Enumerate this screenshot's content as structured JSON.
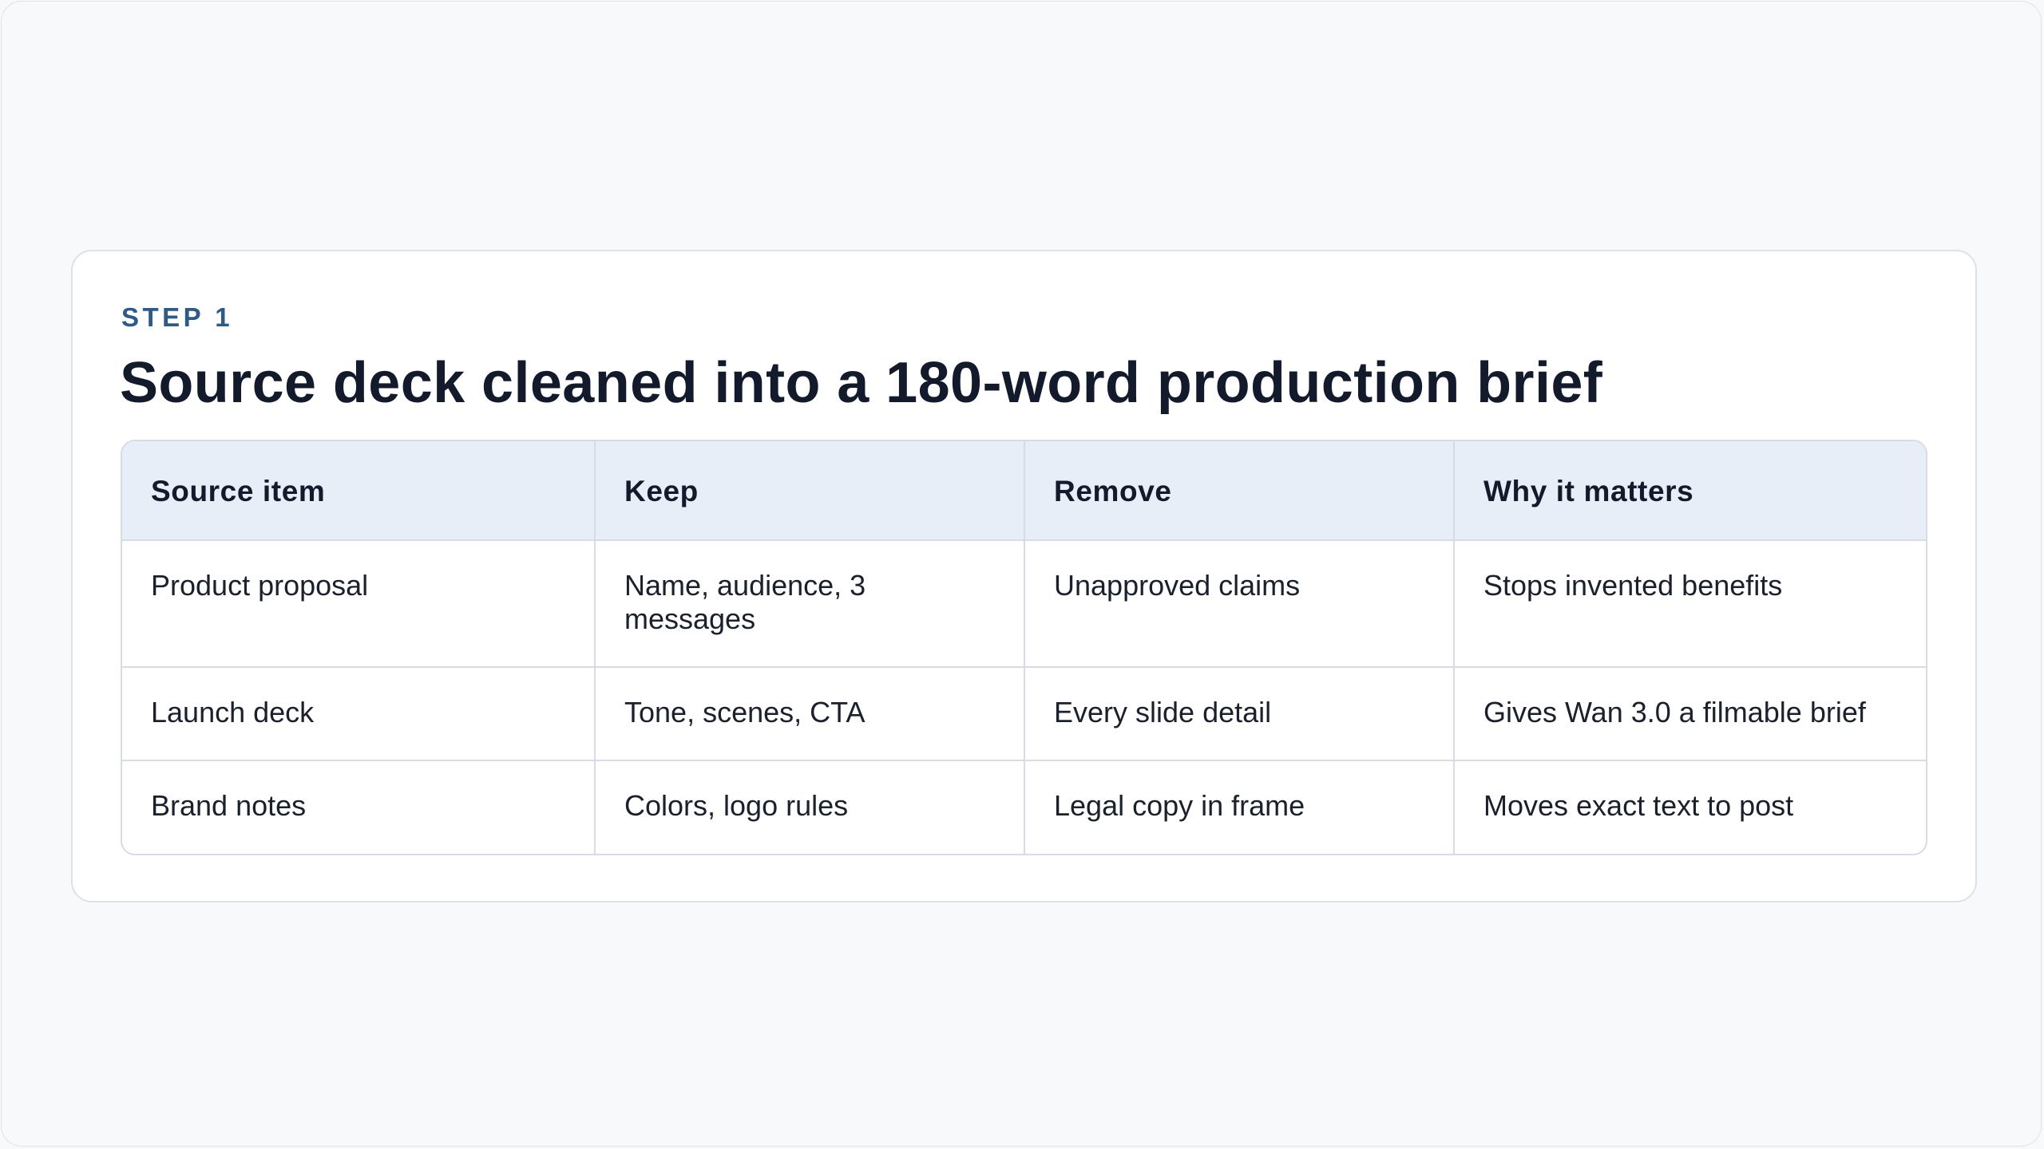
{
  "step_label": "STEP 1",
  "title": "Source deck cleaned into a 180-word production brief",
  "table": {
    "headers": [
      "Source item",
      "Keep",
      "Remove",
      "Why it matters"
    ],
    "rows": [
      [
        "Product proposal",
        "Name, audience, 3 messages",
        "Unapproved claims",
        "Stops invented benefits"
      ],
      [
        "Launch deck",
        "Tone, scenes, CTA",
        "Every slide detail",
        "Gives Wan 3.0 a filmable brief"
      ],
      [
        "Brand notes",
        "Colors, logo rules",
        "Legal copy in frame",
        "Moves exact text to post"
      ]
    ]
  },
  "colors": {
    "accent": "#2d5a87",
    "title": "#131a2b",
    "header_bg": "#e8eef7",
    "border": "#d6dbe4",
    "page_bg": "#f8f9fb"
  }
}
